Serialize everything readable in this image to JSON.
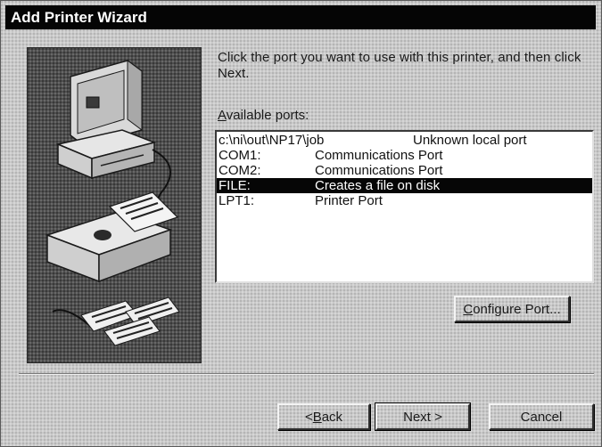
{
  "window": {
    "title": "Add Printer Wizard"
  },
  "instruction": {
    "text": "Click the port you want to use with this printer, and then click Next."
  },
  "ports": {
    "label_accel": "A",
    "label_rest": "vailable ports:",
    "items": [
      {
        "port": "c:\\ni\\out\\NP17\\job",
        "description": "Unknown local port",
        "selected": false
      },
      {
        "port": "COM1:",
        "description": "Communications Port",
        "selected": false
      },
      {
        "port": "COM2:",
        "description": "Communications Port",
        "selected": false
      },
      {
        "port": "FILE:",
        "description": "Creates a file on disk",
        "selected": true
      },
      {
        "port": "LPT1:",
        "description": "Printer Port",
        "selected": false
      }
    ]
  },
  "buttons": {
    "configure_accel": "C",
    "configure_rest": "onfigure Port...",
    "back_prefix": "< ",
    "back_accel": "B",
    "back_rest": "ack",
    "next_label": "Next >",
    "cancel_label": "Cancel"
  },
  "illustration": {
    "icon": "computer-printer-illustration"
  }
}
